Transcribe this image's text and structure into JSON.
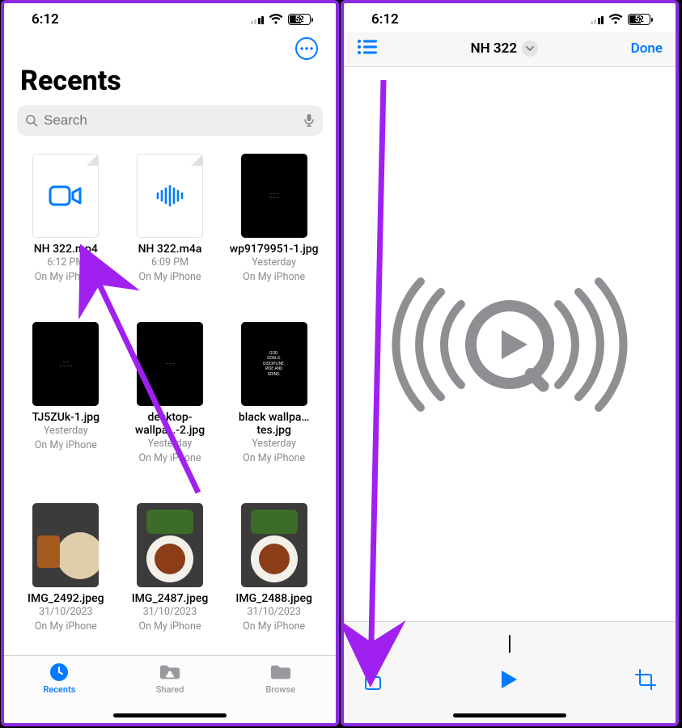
{
  "status": {
    "time": "6:12",
    "battery": "52"
  },
  "left": {
    "title": "Recents",
    "search_placeholder": "Search",
    "files": [
      {
        "name": "NH 322.mp4",
        "line1": "6:12 PM",
        "line2": "On My iPhone"
      },
      {
        "name": "NH 322.m4a",
        "line1": "6:09 PM",
        "line2": "On My iPhone"
      },
      {
        "name": "wp9179951-1.jpg",
        "line1": "Yesterday",
        "line2": "On My iPhone"
      },
      {
        "name": "TJ5ZUk-1.jpg",
        "line1": "Yesterday",
        "line2": "On My iPhone"
      },
      {
        "name": "desktop-wallpa…-2.jpg",
        "line1": "Yesterday",
        "line2": "On My iPhone"
      },
      {
        "name": "black wallpa…tes.jpg",
        "line1": "Yesterday",
        "line2": "On My iPhone"
      },
      {
        "name": "IMG_2492.jpeg",
        "line1": "31/10/2023",
        "line2": "On My iPhone"
      },
      {
        "name": "IMG_2487.jpeg",
        "line1": "31/10/2023",
        "line2": "On My iPhone"
      },
      {
        "name": "IMG_2488.jpeg",
        "line1": "31/10/2023",
        "line2": "On My iPhone"
      }
    ],
    "tabs": {
      "recents": "Recents",
      "shared": "Shared",
      "browse": "Browse"
    }
  },
  "right": {
    "title": "NH 322",
    "done": "Done"
  },
  "black_thumb_texts": {
    "t5": "GOD.\nGOALS.\nDISCIPLINE.\nRISE AND\nGRIND."
  }
}
